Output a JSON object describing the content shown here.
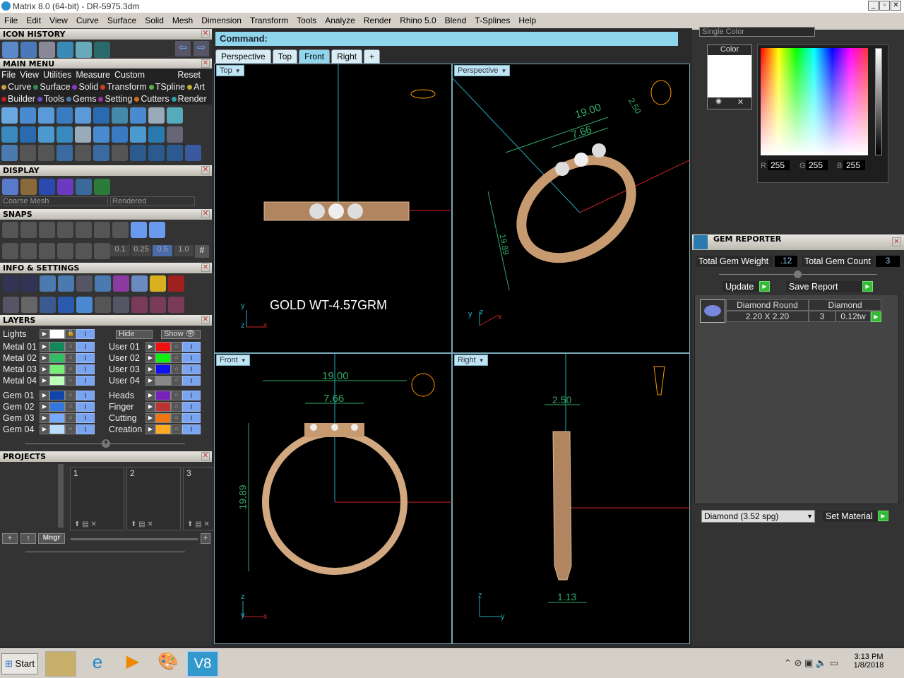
{
  "window": {
    "title": "Matrix 8.0 (64-bit) - DR-5975.3dm",
    "controls": [
      "_",
      "▫",
      "✕"
    ]
  },
  "menu": [
    "File",
    "Edit",
    "View",
    "Curve",
    "Surface",
    "Solid",
    "Mesh",
    "Dimension",
    "Transform",
    "Tools",
    "Analyze",
    "Render",
    "Rhino 5.0",
    "Blend",
    "T-Splines",
    "Help"
  ],
  "left": {
    "icon_history": "ICON HISTORY",
    "main_menu": {
      "title": "MAIN MENU",
      "menu": [
        "File",
        "View",
        "Utilities",
        "Measure",
        "Custom"
      ],
      "reset": "Reset",
      "row1": [
        {
          "label": "Curve",
          "color": "#c8a040"
        },
        {
          "label": "Surface",
          "color": "#2f8a5a"
        },
        {
          "label": "Solid",
          "color": "#8a3ac0"
        },
        {
          "label": "Transform",
          "color": "#d04020"
        },
        {
          "label": "TSpline",
          "color": "#60b040"
        },
        {
          "label": "Art",
          "color": "#c0b030"
        }
      ],
      "row2": [
        {
          "label": "Builder",
          "color": "#c02020"
        },
        {
          "label": "Tools",
          "color": "#6a4ac0"
        },
        {
          "label": "Gems",
          "color": "#4a7ab0"
        },
        {
          "label": "Setting",
          "color": "#a030a0"
        },
        {
          "label": "Cutters",
          "color": "#d07020"
        },
        {
          "label": "Render",
          "color": "#30a0a0"
        }
      ]
    },
    "display": {
      "title": "DISPLAY",
      "mesh": "Coarse Mesh",
      "mode": "Rendered"
    },
    "snaps": {
      "title": "SNAPS",
      "values": [
        "0.1",
        "0.25",
        "0.5",
        "1.0"
      ],
      "selected": "0.5"
    },
    "info": "INFO & SETTINGS",
    "layers": {
      "title": "LAYERS",
      "lights": "Lights",
      "hide": "Hide",
      "show": "Show",
      "left": [
        {
          "name": "Metal 01",
          "color": "#118855"
        },
        {
          "name": "Metal 02",
          "color": "#33bb66"
        },
        {
          "name": "Metal 03",
          "color": "#77ee77"
        },
        {
          "name": "Metal 04",
          "color": "#bbffbb"
        },
        {
          "name": "Gem 01",
          "color": "#1144aa"
        },
        {
          "name": "Gem 02",
          "color": "#3377dd"
        },
        {
          "name": "Gem 03",
          "color": "#77aaff"
        },
        {
          "name": "Gem 04",
          "color": "#bbddff"
        }
      ],
      "right": [
        {
          "name": "User 01",
          "color": "#ee1111"
        },
        {
          "name": "User 02",
          "color": "#11ee11"
        },
        {
          "name": "User 03",
          "color": "#1111ee"
        },
        {
          "name": "User 04",
          "color": "#888888"
        },
        {
          "name": "Heads",
          "color": "#7722bb"
        },
        {
          "name": "Finger",
          "color": "#bb3333"
        },
        {
          "name": "Cutting",
          "color": "#ee7711"
        },
        {
          "name": "Creation",
          "color": "#ffaa22"
        }
      ]
    },
    "projects": {
      "title": "PROJECTS",
      "slots": [
        "1",
        "2",
        "3"
      ],
      "mngr": "Mngr"
    }
  },
  "command": {
    "label": "Command:"
  },
  "tabs": [
    "Perspective",
    "Top",
    "Front",
    "Right",
    "+"
  ],
  "active_tab": "Front",
  "viewports": {
    "top": {
      "label": "Top",
      "annotation": "GOLD WT-4.57GRM",
      "axes": [
        "y",
        "z",
        "x"
      ]
    },
    "perspective": {
      "label": "Perspective",
      "dims": [
        "19.00",
        "7.66",
        "2.50",
        "19.89"
      ],
      "axes": [
        "y",
        "z",
        "x"
      ]
    },
    "front": {
      "label": "Front",
      "dims": [
        "19.00",
        "7.66",
        "19.89"
      ],
      "axes": [
        "z",
        "y",
        "x"
      ]
    },
    "right": {
      "label": "Right",
      "dims": [
        "2.50",
        "1.13"
      ],
      "axes": [
        "z",
        "y"
      ]
    }
  },
  "color_panel": {
    "mode": "Single Color",
    "color_label": "Color",
    "r": "255",
    "g": "255",
    "b": "255",
    "r_label": "R",
    "g_label": "G",
    "b_label": "B"
  },
  "gem_reporter": {
    "title": "GEM REPORTER",
    "weight_label": "Total Gem Weight",
    "weight": ".12",
    "count_label": "Total Gem Count",
    "count": "3",
    "update": "Update",
    "save": "Save Report",
    "row": {
      "shape": "Diamond Round",
      "size": "2.20 X 2.20",
      "material": "Diamond",
      "qty": "3",
      "weight": "0.12tw"
    },
    "material_select": "Diamond    (3.52 spg)",
    "set_material": "Set Material"
  },
  "taskbar": {
    "start": "Start",
    "time": "3:13 PM",
    "date": "1/8/2018"
  }
}
